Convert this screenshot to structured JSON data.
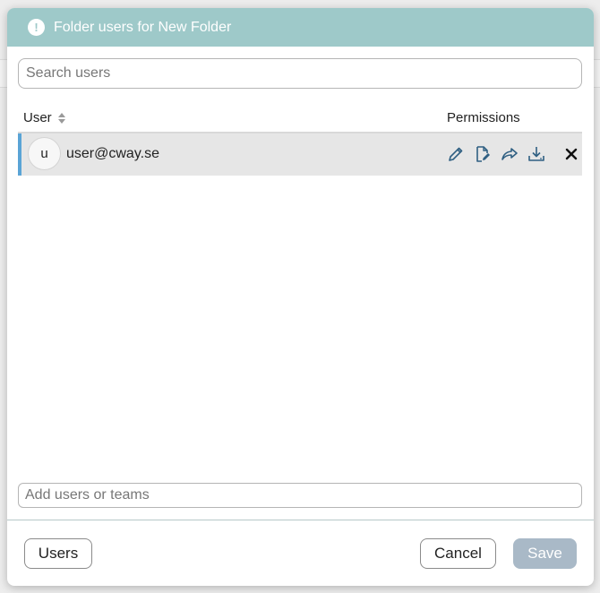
{
  "dialog": {
    "title": "Folder users for New Folder",
    "header_color": "#9ec9c9",
    "header_icon": "exclamation-circle-icon"
  },
  "search": {
    "placeholder": "Search users",
    "value": ""
  },
  "table": {
    "columns": {
      "user": "User",
      "permissions": "Permissions"
    },
    "rows": [
      {
        "avatar_letter": "u",
        "email": "user@cway.se",
        "permission_icons": [
          "pencil-icon",
          "file-edit-icon",
          "share-icon",
          "download-icon"
        ],
        "remove_icon": "close-icon",
        "accent": "#5aa4d6"
      }
    ]
  },
  "add_users": {
    "placeholder": "Add users or teams",
    "value": ""
  },
  "footer": {
    "users_label": "Users",
    "cancel_label": "Cancel",
    "save_label": "Save",
    "save_color": "#a9b9c7"
  }
}
